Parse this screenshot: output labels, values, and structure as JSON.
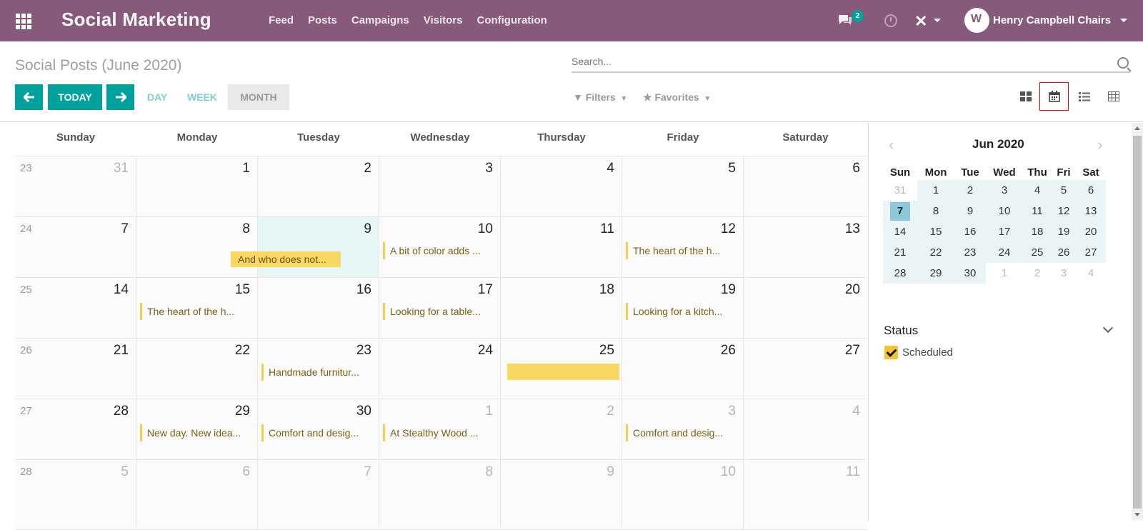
{
  "navbar": {
    "brand": "Social Marketing",
    "menu": [
      "Feed",
      "Posts",
      "Campaigns",
      "Visitors",
      "Configuration"
    ],
    "chat_badge": "2",
    "user_name": "Henry Campbell Chairs",
    "color": "#875a7b"
  },
  "control_panel": {
    "title": "Social Posts (June 2020)",
    "search_placeholder": "Search...",
    "today_label": "TODAY",
    "scales": [
      "DAY",
      "WEEK",
      "MONTH"
    ],
    "active_scale": "MONTH",
    "filters_label": "Filters",
    "favorites_label": "Favorites",
    "accent": "#00a09d"
  },
  "calendar": {
    "weekdays": [
      "Sunday",
      "Monday",
      "Tuesday",
      "Wednesday",
      "Thursday",
      "Friday",
      "Saturday"
    ],
    "weeks": [
      {
        "week": "23",
        "days": [
          {
            "d": "31",
            "other": true
          },
          {
            "d": "1"
          },
          {
            "d": "2"
          },
          {
            "d": "3"
          },
          {
            "d": "4"
          },
          {
            "d": "5"
          },
          {
            "d": "6"
          }
        ]
      },
      {
        "week": "24",
        "days": [
          {
            "d": "7"
          },
          {
            "d": "8"
          },
          {
            "d": "9",
            "today": true
          },
          {
            "d": "10",
            "event": "A bit of color adds ..."
          },
          {
            "d": "11"
          },
          {
            "d": "12",
            "event": "The heart of the h..."
          },
          {
            "d": "13"
          }
        ]
      },
      {
        "week": "25",
        "days": [
          {
            "d": "14"
          },
          {
            "d": "15",
            "event": "The heart of the h..."
          },
          {
            "d": "16"
          },
          {
            "d": "17",
            "event": "Looking for a table..."
          },
          {
            "d": "18"
          },
          {
            "d": "19",
            "event": "Looking for a kitch..."
          },
          {
            "d": "20"
          }
        ]
      },
      {
        "week": "26",
        "days": [
          {
            "d": "21"
          },
          {
            "d": "22"
          },
          {
            "d": "23",
            "event": "Handmade furnitur..."
          },
          {
            "d": "24"
          },
          {
            "d": "25"
          },
          {
            "d": "26"
          },
          {
            "d": "27"
          }
        ]
      },
      {
        "week": "27",
        "days": [
          {
            "d": "28"
          },
          {
            "d": "29",
            "event": "New day. New idea..."
          },
          {
            "d": "30",
            "event": "Comfort and desig..."
          },
          {
            "d": "1",
            "other": true,
            "event": "At Stealthy Wood ..."
          },
          {
            "d": "2",
            "other": true
          },
          {
            "d": "3",
            "other": true,
            "event": "Comfort and desig..."
          },
          {
            "d": "4",
            "other": true
          }
        ]
      },
      {
        "week": "28",
        "days": [
          {
            "d": "5",
            "other": true
          },
          {
            "d": "6",
            "other": true
          },
          {
            "d": "7",
            "other": true
          },
          {
            "d": "8",
            "other": true
          },
          {
            "d": "9",
            "other": true
          },
          {
            "d": "10",
            "other": true
          },
          {
            "d": "11",
            "other": true
          }
        ]
      }
    ],
    "dragging_event": "And who does not...",
    "event_color": "#f4cf4a"
  },
  "sidebar": {
    "month_title": "Jun 2020",
    "weekdays": [
      "Sun",
      "Mon",
      "Tue",
      "Wed",
      "Thu",
      "Fri",
      "Sat"
    ],
    "rows": [
      [
        "31",
        "1",
        "2",
        "3",
        "4",
        "5",
        "6"
      ],
      [
        "7",
        "8",
        "9",
        "10",
        "11",
        "12",
        "13"
      ],
      [
        "14",
        "15",
        "16",
        "17",
        "18",
        "19",
        "20"
      ],
      [
        "21",
        "22",
        "23",
        "24",
        "25",
        "26",
        "27"
      ],
      [
        "28",
        "29",
        "30",
        "1",
        "2",
        "3",
        "4"
      ]
    ],
    "selected": "7",
    "status_title": "Status",
    "status_option": "Scheduled"
  }
}
